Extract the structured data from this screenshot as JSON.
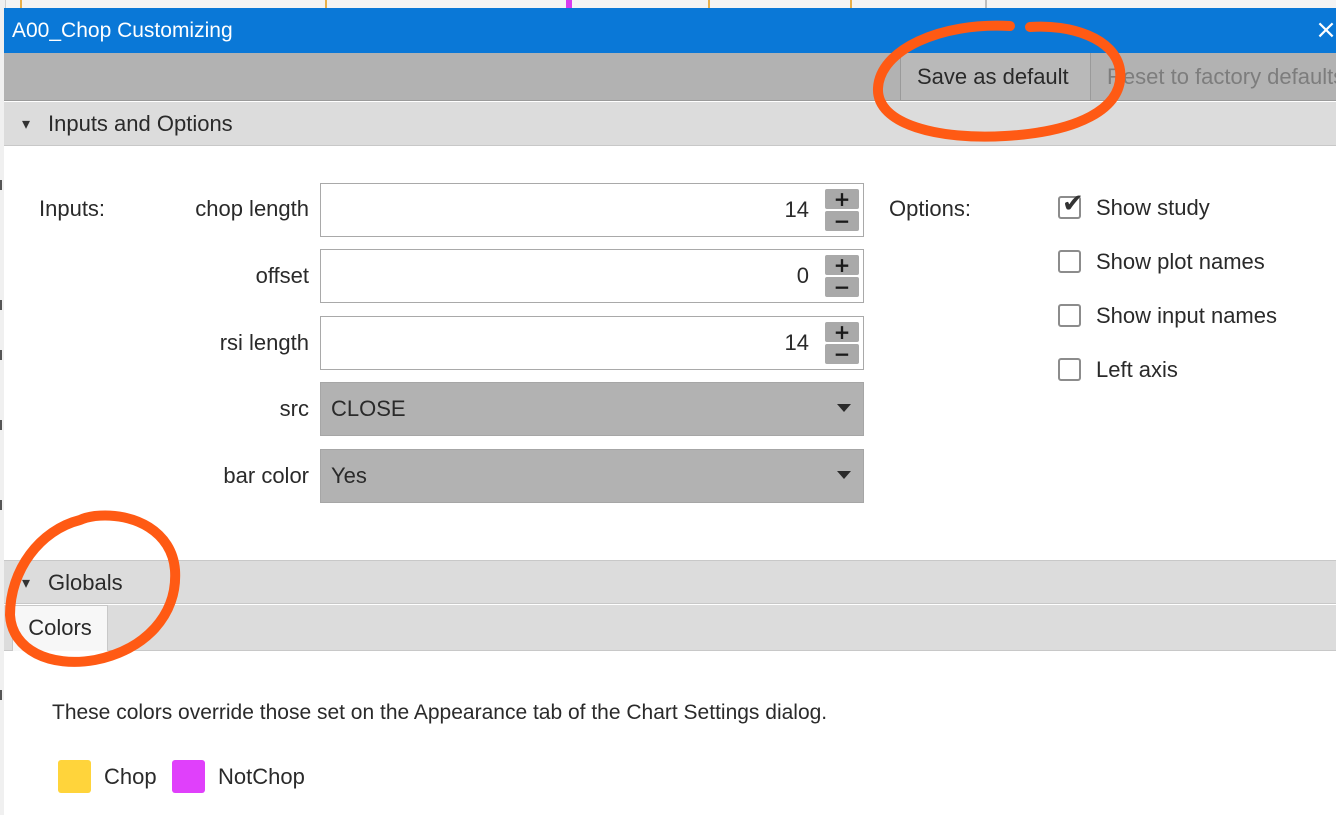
{
  "window": {
    "title": "A00_Chop Customizing",
    "close_glyph": "×"
  },
  "toolbar": {
    "save_default_label": "Save as default",
    "reset_factory_label": "Reset to factory defaults"
  },
  "sections": {
    "inputs_options": {
      "label": "Inputs and Options",
      "chevron": "▾"
    },
    "globals": {
      "label": "Globals",
      "chevron": "▾"
    }
  },
  "inputs": {
    "heading": "Inputs:",
    "chop_length": {
      "label": "chop length",
      "value": "14"
    },
    "offset": {
      "label": "offset",
      "value": "0"
    },
    "rsi_length": {
      "label": "rsi length",
      "value": "14"
    },
    "src": {
      "label": "src",
      "value": "CLOSE"
    },
    "bar_color": {
      "label": "bar color",
      "value": "Yes"
    },
    "stepper": {
      "plus": "+",
      "minus": "−"
    }
  },
  "options": {
    "heading": "Options:",
    "items": [
      {
        "label": "Show study",
        "checked": true
      },
      {
        "label": "Show plot names",
        "checked": false
      },
      {
        "label": "Show input names",
        "checked": false
      },
      {
        "label": "Left axis",
        "checked": false
      }
    ],
    "check_glyph": "✔"
  },
  "globals": {
    "tab_colors": "Colors",
    "info": "These colors override those set on the Appearance tab of the Chart Settings dialog.",
    "swatches": [
      {
        "label": "Chop",
        "color": "#FFD43B"
      },
      {
        "label": "NotChop",
        "color": "#E040FB"
      }
    ]
  },
  "colors": {
    "titlebar": "#0A78D7",
    "toolbar": "#B2B2B2",
    "annotation": "#FF5A14"
  }
}
